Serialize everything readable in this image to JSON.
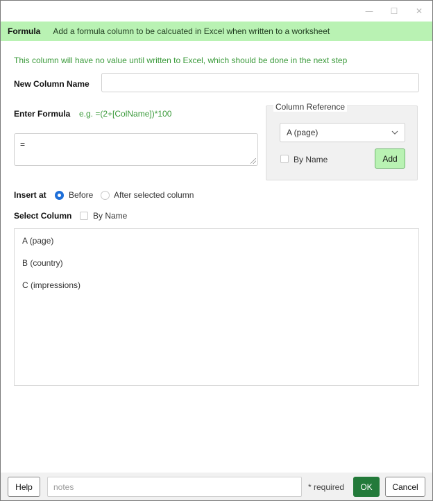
{
  "window": {
    "minimize_glyph": "—",
    "maximize_glyph": "☐",
    "close_glyph": "✕"
  },
  "header": {
    "title": "Formula",
    "description": "Add a formula column to be calcuated in Excel when written to a worksheet",
    "background": "#b9f2b3"
  },
  "info": "This column will have no value until written to Excel, which should be done in the next step",
  "new_column": {
    "label": "New Column Name",
    "value": ""
  },
  "formula": {
    "label": "Enter Formula",
    "example": "e.g. =(2+[ColName])*100",
    "value": "="
  },
  "column_reference": {
    "legend": "Column Reference",
    "selected": "A (page)",
    "by_name_label": "By Name",
    "by_name_checked": false,
    "add_label": "Add"
  },
  "insert_at": {
    "label": "Insert at",
    "options": [
      {
        "label": "Before",
        "selected": true
      },
      {
        "label": "After selected column",
        "selected": false
      }
    ]
  },
  "select_column": {
    "label": "Select Column",
    "by_name_label": "By Name",
    "by_name_checked": false,
    "items": [
      "A (page)",
      "B (country)",
      "C (impressions)"
    ]
  },
  "footer": {
    "help_label": "Help",
    "notes_placeholder": "notes",
    "required_text": "* required",
    "ok_label": "OK",
    "cancel_label": "Cancel"
  },
  "colors": {
    "accent_green": "#3a9a3a",
    "ok_green": "#237a3a",
    "radio_blue": "#1e6fd9"
  },
  "icons": {
    "dropdown": "chevron-down-icon",
    "resize": "resize-grip-icon"
  }
}
